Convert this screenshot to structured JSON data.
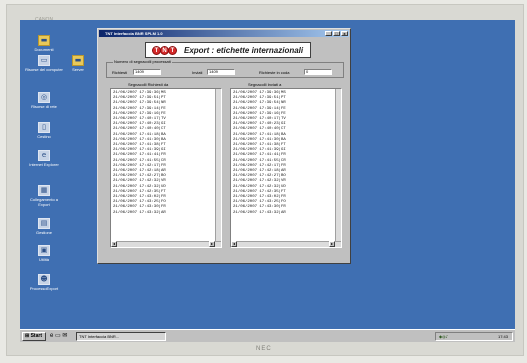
{
  "monitor": {
    "bezel_text": "CANON",
    "brand": "NEC"
  },
  "desktop_icons": [
    {
      "label": "Documenti",
      "icon": "folder-icon"
    },
    {
      "label": "Risorse del computer",
      "icon": "computer-icon"
    },
    {
      "label": "Risorse di rete",
      "icon": "network-icon"
    },
    {
      "label": "Cestino",
      "icon": "recycle-bin-icon"
    },
    {
      "label": "Internet Explorer",
      "icon": "internet-explorer-icon"
    },
    {
      "label": "Collegamento a Export",
      "icon": "shortcut-icon"
    },
    {
      "label": "Gestione",
      "icon": "app-icon"
    },
    {
      "label": "Utilità",
      "icon": "utility-icon"
    },
    {
      "label": "ProcessoExport",
      "icon": "user-icon"
    },
    {
      "label": "Server",
      "icon": "folder-icon"
    }
  ],
  "window": {
    "title": "TNT Interfaccia BNR SPLM 1.0",
    "header_title": "Export : etichette internazionali",
    "logo_letters": [
      "T",
      "N",
      "T"
    ],
    "buttons": {
      "minimize": "_",
      "maximize": "□",
      "close": "x"
    },
    "group_label": "Numero di segnacolli processati",
    "fields": [
      {
        "label": "Richiesti",
        "value": "1409"
      },
      {
        "label": "Inviati",
        "value": "1409"
      },
      {
        "label": "Richieste in coda",
        "value": "0"
      }
    ],
    "left_list_label": "Segnacolli Richiesti da",
    "right_list_label": "Segnacolli Inviati a",
    "left_rows": [
      "21/06/2007 17:39:36|MS",
      "21/06/2007 17:39:51|PT",
      "21/06/2007 17:39:54|NR",
      "21/06/2007 17:39:14|FE",
      "21/06/2007 17:39:16|FE",
      "21/06/2007 17:40:17|TV",
      "21/06/2007 17:40:23|GI",
      "21/06/2007 17:40:40|CT",
      "21/06/2007 17:41:18|BA",
      "21/06/2007 17:41:30|BA",
      "21/06/2007 17:41:38|FT",
      "21/06/2007 17:41:39|GI",
      "21/06/2007 17:41:41|FR",
      "21/06/2007 17:41:55|CR",
      "21/06/2007 17:42:17|FR",
      "21/06/2007 17:42:18|AR",
      "21/06/2007 17:42:27|BO",
      "21/06/2007 17:42:32|VR",
      "21/06/2007 17:42:32|UD",
      "21/06/2007 17:42:35|FT",
      "21/06/2007 17:43:02|FR",
      "21/06/2007 17:43:25|FO",
      "21/06/2007 17:43:30|FR",
      "21/06/2007 17:43:32|AR"
    ],
    "right_rows": [
      "21/06/2007 17:39:36|MS",
      "21/06/2007 17:39:51|PT",
      "21/06/2007 17:39:54|NR",
      "21/06/2007 17:39:14|FE",
      "21/06/2007 17:39:16|FE",
      "21/06/2007 17:40:17|TV",
      "21/06/2007 17:40:23|GI",
      "21/06/2007 17:40:40|CT",
      "21/06/2007 17:41:18|BA",
      "21/06/2007 17:41:30|BA",
      "21/06/2007 17:41:38|FT",
      "21/06/2007 17:41:39|GI",
      "21/06/2007 17:41:41|FR",
      "21/06/2007 17:41:55|CR",
      "21/06/2007 17:42:17|FR",
      "21/06/2007 17:42:18|AR",
      "21/06/2007 17:42:27|BO",
      "21/06/2007 17:42:32|VR",
      "21/06/2007 17:42:32|UD",
      "21/06/2007 17:42:35|FT",
      "21/06/2007 17:43:02|FR",
      "21/06/2007 17:43:25|FO",
      "21/06/2007 17:43:30|FR",
      "21/06/2007 17:43:32|AR"
    ]
  },
  "taskbar": {
    "start_label": "Start",
    "quick_launch_icons": [
      "ie-icon",
      "desktop-icon",
      "outlook-icon"
    ],
    "task_label": "TNT Interfaccia BNR...",
    "tray_icons": [
      "network-icon",
      "volume-icon",
      "antivirus-icon"
    ],
    "clock": "17:43"
  },
  "colors": {
    "desktop": "#3f6fb2",
    "title_start": "#0a246a",
    "title_end": "#a6caf0",
    "logo_red": "#d42a2a"
  }
}
